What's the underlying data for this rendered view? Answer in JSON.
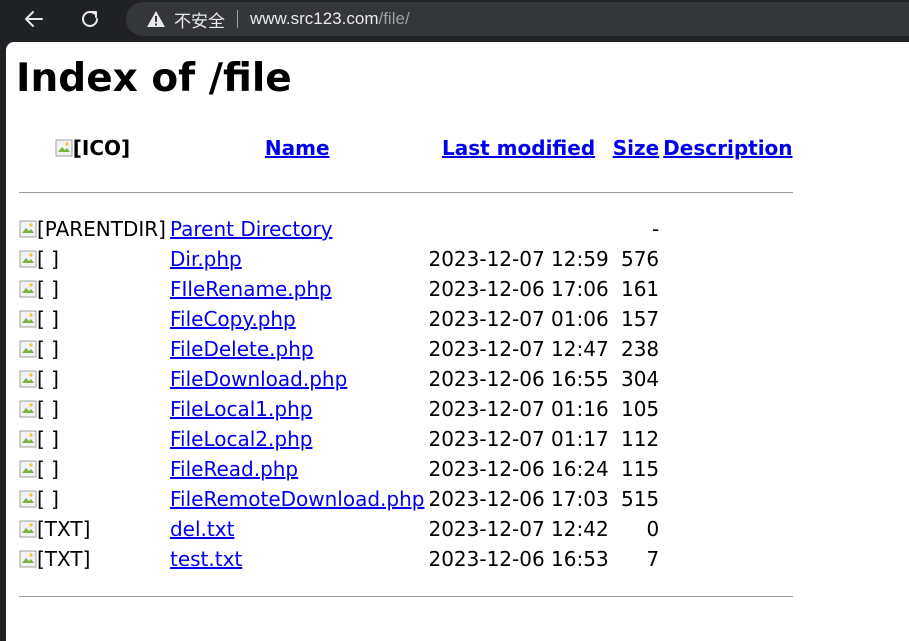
{
  "browser": {
    "security_label": "不安全",
    "url_host": "www.src123.com",
    "url_path": "/file/"
  },
  "page": {
    "title": "Index of /file"
  },
  "table": {
    "headers": {
      "icon": "[ICO]",
      "name": "Name",
      "last_modified": "Last modified",
      "size": "Size",
      "description": "Description"
    },
    "rows": [
      {
        "icon": "[PARENTDIR]",
        "name": "Parent Directory",
        "modified": "",
        "size": "-"
      },
      {
        "icon": "[ ]",
        "name": "Dir.php",
        "modified": "2023-12-07 12:59",
        "size": "576"
      },
      {
        "icon": "[ ]",
        "name": "FIleRename.php",
        "modified": "2023-12-06 17:06",
        "size": "161"
      },
      {
        "icon": "[ ]",
        "name": "FileCopy.php",
        "modified": "2023-12-07 01:06",
        "size": "157"
      },
      {
        "icon": "[ ]",
        "name": "FileDelete.php",
        "modified": "2023-12-07 12:47",
        "size": "238"
      },
      {
        "icon": "[ ]",
        "name": "FileDownload.php",
        "modified": "2023-12-06 16:55",
        "size": "304"
      },
      {
        "icon": "[ ]",
        "name": "FileLocal1.php",
        "modified": "2023-12-07 01:16",
        "size": "105"
      },
      {
        "icon": "[ ]",
        "name": "FileLocal2.php",
        "modified": "2023-12-07 01:17",
        "size": "112"
      },
      {
        "icon": "[ ]",
        "name": "FileRead.php",
        "modified": "2023-12-06 16:24",
        "size": "115"
      },
      {
        "icon": "[ ]",
        "name": "FileRemoteDownload.php",
        "modified": "2023-12-06 17:03",
        "size": "515"
      },
      {
        "icon": "[TXT]",
        "name": "del.txt",
        "modified": "2023-12-07 12:42",
        "size": "0"
      },
      {
        "icon": "[TXT]",
        "name": "test.txt",
        "modified": "2023-12-06 16:53",
        "size": "7"
      }
    ]
  }
}
